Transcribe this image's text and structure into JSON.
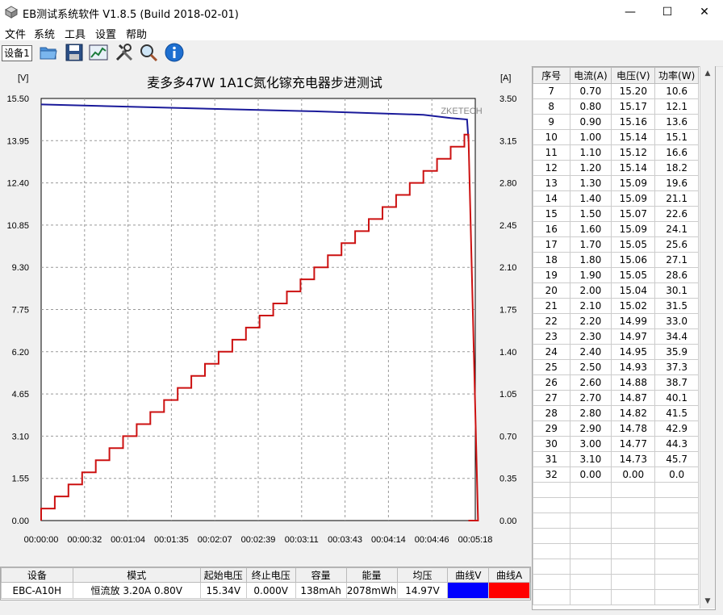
{
  "window": {
    "title": "EB测试系统软件 V1.8.5 (Build 2018-02-01)",
    "minimize": "—",
    "maximize": "☐",
    "close": "✕"
  },
  "menu": [
    "文件",
    "系统",
    "工具",
    "设置",
    "帮助"
  ],
  "toolbar": {
    "device_label": "设备1",
    "icons": [
      "folder-icon",
      "save-icon",
      "chart-icon",
      "tools-icon",
      "search-icon",
      "info-icon"
    ]
  },
  "chart_data": {
    "type": "line",
    "title": "麦多多47W 1A1C氮化镓充电器步进测试",
    "watermark": "ZKETECH",
    "left_unit": "[V]",
    "right_unit": "[A]",
    "y_left_ticks": [
      "15.50",
      "13.95",
      "12.40",
      "10.85",
      "9.30",
      "7.75",
      "6.20",
      "4.65",
      "3.10",
      "1.55",
      "0.00"
    ],
    "y_right_ticks": [
      "3.50",
      "3.15",
      "2.80",
      "2.45",
      "2.10",
      "1.75",
      "1.40",
      "1.05",
      "0.70",
      "0.35",
      "0.00"
    ],
    "x_ticks": [
      "00:00:00",
      "00:00:32",
      "00:01:04",
      "00:01:35",
      "00:02:07",
      "00:02:39",
      "00:03:11",
      "00:03:43",
      "00:04:14",
      "00:04:46",
      "00:05:18"
    ],
    "ylim_left": [
      0,
      15.5
    ],
    "ylim_right": [
      0,
      3.5
    ],
    "xlim_seconds": [
      0,
      318
    ],
    "voltage_color": "#1a1a9a",
    "current_color": "#cc1111",
    "current_step_seconds": 10,
    "current_steps": [
      0.1,
      0.2,
      0.3,
      0.4,
      0.5,
      0.6,
      0.7,
      0.8,
      0.9,
      1.0,
      1.1,
      1.2,
      1.3,
      1.4,
      1.5,
      1.6,
      1.7,
      1.8,
      1.9,
      2.0,
      2.1,
      2.2,
      2.3,
      2.4,
      2.5,
      2.6,
      2.7,
      2.8,
      2.9,
      3.0,
      3.1,
      3.2,
      0.0
    ],
    "voltage_points": [
      [
        0,
        15.28
      ],
      [
        100,
        15.15
      ],
      [
        200,
        15.03
      ],
      [
        280,
        14.9
      ],
      [
        300,
        14.78
      ],
      [
        312,
        14.73
      ],
      [
        313,
        14.0
      ]
    ]
  },
  "table": {
    "headers": [
      "序号",
      "电流(A)",
      "电压(V)",
      "功率(W)"
    ],
    "rows": [
      [
        "7",
        "0.70",
        "15.20",
        "10.6"
      ],
      [
        "8",
        "0.80",
        "15.17",
        "12.1"
      ],
      [
        "9",
        "0.90",
        "15.16",
        "13.6"
      ],
      [
        "10",
        "1.00",
        "15.14",
        "15.1"
      ],
      [
        "11",
        "1.10",
        "15.12",
        "16.6"
      ],
      [
        "12",
        "1.20",
        "15.14",
        "18.2"
      ],
      [
        "13",
        "1.30",
        "15.09",
        "19.6"
      ],
      [
        "14",
        "1.40",
        "15.09",
        "21.1"
      ],
      [
        "15",
        "1.50",
        "15.07",
        "22.6"
      ],
      [
        "16",
        "1.60",
        "15.09",
        "24.1"
      ],
      [
        "17",
        "1.70",
        "15.05",
        "25.6"
      ],
      [
        "18",
        "1.80",
        "15.06",
        "27.1"
      ],
      [
        "19",
        "1.90",
        "15.05",
        "28.6"
      ],
      [
        "20",
        "2.00",
        "15.04",
        "30.1"
      ],
      [
        "21",
        "2.10",
        "15.02",
        "31.5"
      ],
      [
        "22",
        "2.20",
        "14.99",
        "33.0"
      ],
      [
        "23",
        "2.30",
        "14.97",
        "34.4"
      ],
      [
        "24",
        "2.40",
        "14.95",
        "35.9"
      ],
      [
        "25",
        "2.50",
        "14.93",
        "37.3"
      ],
      [
        "26",
        "2.60",
        "14.88",
        "38.7"
      ],
      [
        "27",
        "2.70",
        "14.87",
        "40.1"
      ],
      [
        "28",
        "2.80",
        "14.82",
        "41.5"
      ],
      [
        "29",
        "2.90",
        "14.78",
        "42.9"
      ],
      [
        "30",
        "3.00",
        "14.77",
        "44.3"
      ],
      [
        "31",
        "3.10",
        "14.73",
        "45.7"
      ],
      [
        "32",
        "0.00",
        "0.00",
        "0.0"
      ]
    ]
  },
  "summary": {
    "headers": [
      "设备",
      "模式",
      "起始电压",
      "终止电压",
      "容量",
      "能量",
      "均压",
      "曲线V",
      "曲线A"
    ],
    "values": [
      "EBC-A10H",
      "恒流放 3.20A 0.80V",
      "15.34V",
      "0.000V",
      "138mAh",
      "2078mWh",
      "14.97V"
    ],
    "curve_v_color": "#0000ff",
    "curve_a_color": "#ff0000"
  }
}
